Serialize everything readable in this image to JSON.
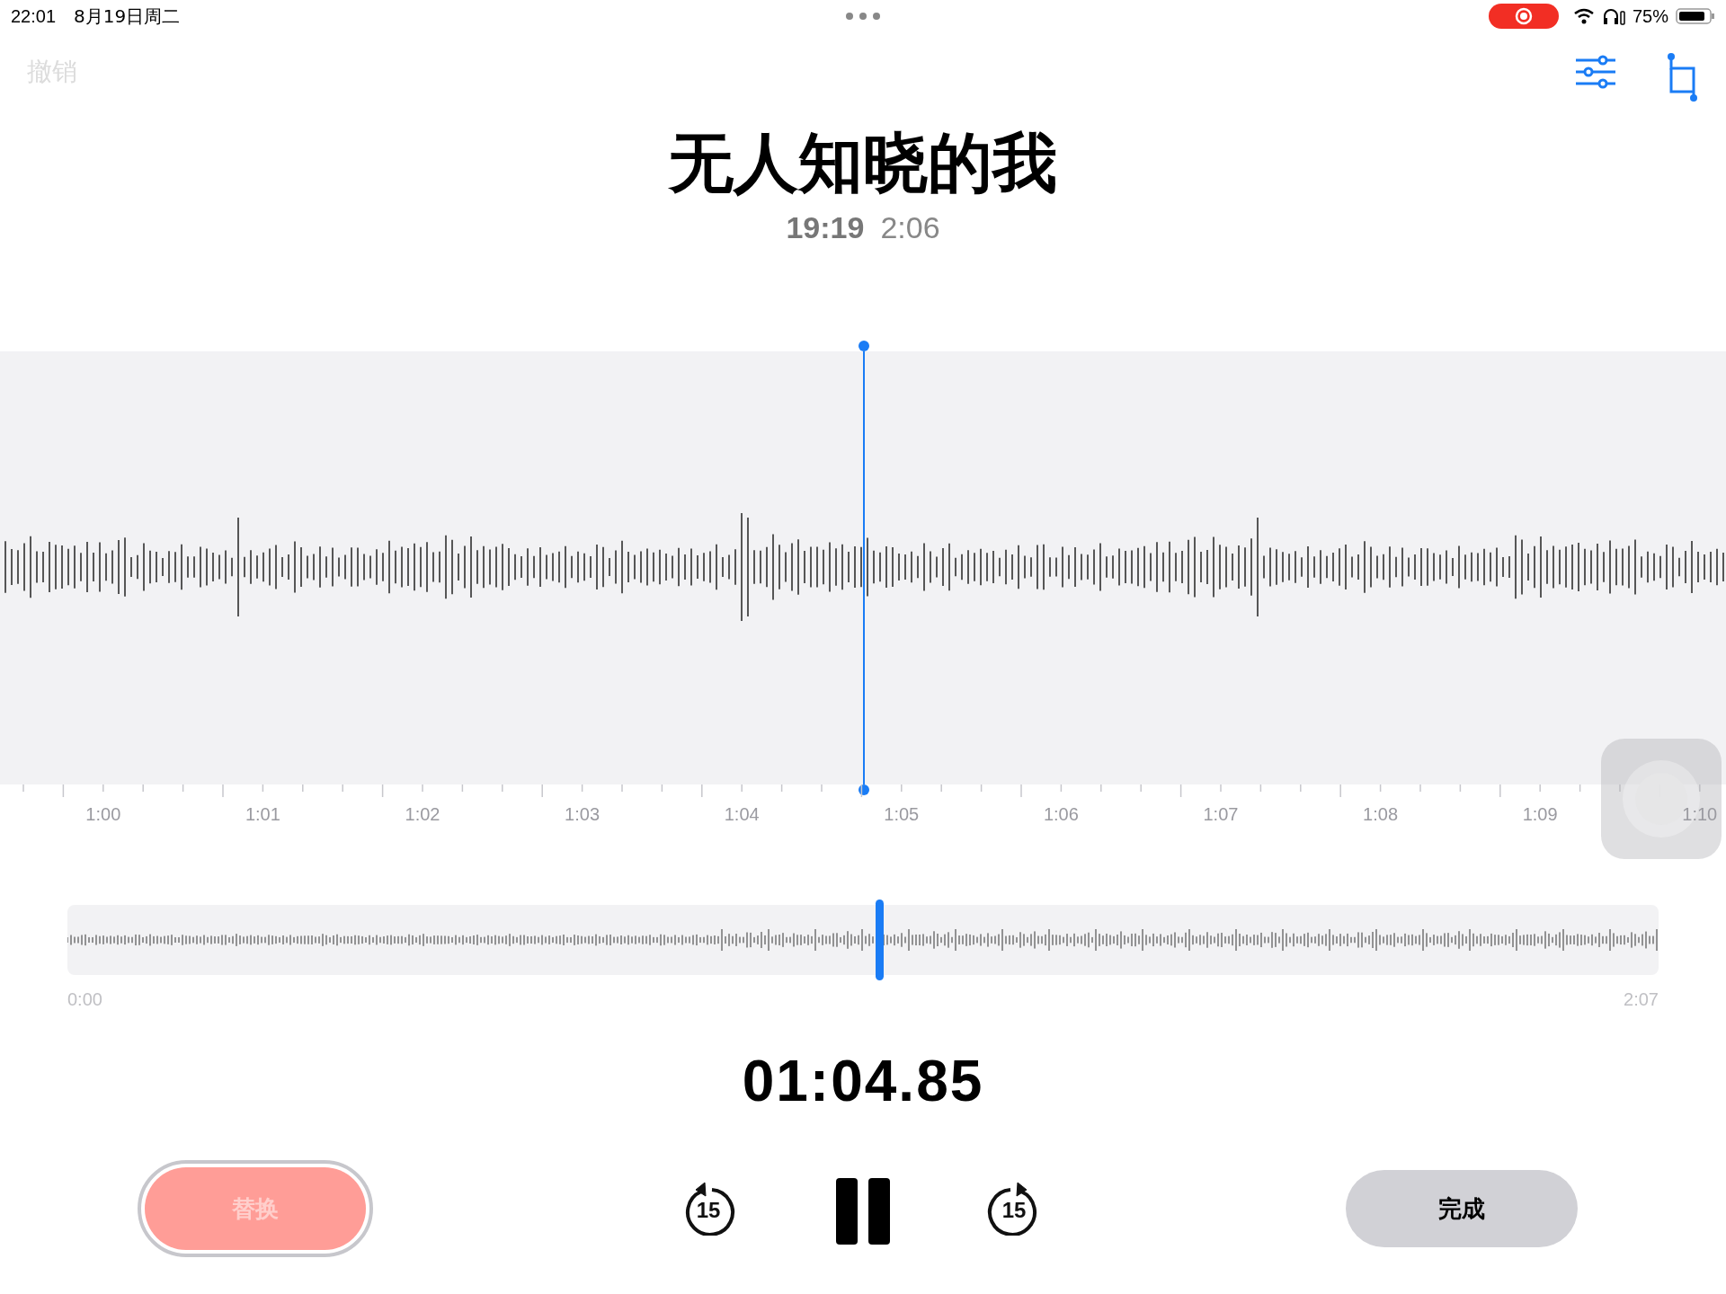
{
  "status_bar": {
    "time": "22:01",
    "date": "8月19日周二",
    "battery": "75%",
    "recording": true
  },
  "toolbar": {
    "undo": {
      "label": "撤销",
      "disabled": true
    }
  },
  "recording": {
    "title": "无人知晓的我",
    "time": "19:19",
    "duration": "2:06"
  },
  "timeline": {
    "labels": [
      "1:00",
      "1:01",
      "1:02",
      "1:03",
      "1:04",
      "1:05",
      "1:06",
      "1:07",
      "1:08",
      "1:09",
      "1:10"
    ]
  },
  "overview": {
    "level": 0.51,
    "start": "0:00",
    "end": "2:07"
  },
  "position": "01:04.85",
  "controls": {
    "replace": {
      "label": "替换",
      "disabled": true
    },
    "skip_back": "15",
    "skip_forward": "15",
    "playing": true,
    "done": {
      "label": "完成"
    }
  }
}
